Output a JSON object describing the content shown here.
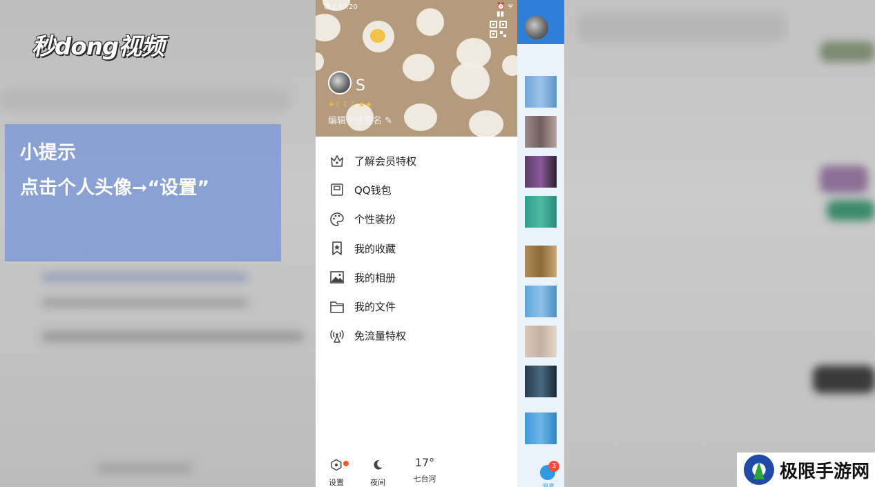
{
  "watermark": {
    "logo_text": "秒dong视频",
    "corner_text": "极限手游网"
  },
  "tip": {
    "title": "小提示",
    "text": "点击个人头像➞“设置”"
  },
  "status_bar": {
    "time": "晚上10:20",
    "icons": "⏰ ᯤ ▮▮"
  },
  "profile": {
    "username": "S",
    "level_icons": "☀☾☾☾★★",
    "signature": "编辑个性签名 ✎"
  },
  "menu": {
    "items": [
      {
        "label": "了解会员特权",
        "icon": "crown-icon"
      },
      {
        "label": "QQ钱包",
        "icon": "wallet-icon"
      },
      {
        "label": "个性装扮",
        "icon": "palette-icon"
      },
      {
        "label": "我的收藏",
        "icon": "bookmark-icon"
      },
      {
        "label": "我的相册",
        "icon": "image-icon"
      },
      {
        "label": "我的文件",
        "icon": "folder-icon"
      },
      {
        "label": "免流量特权",
        "icon": "antenna-icon"
      }
    ]
  },
  "bottom_bar": {
    "settings_label": "设置",
    "night_label": "夜间",
    "temperature": "17°",
    "location": "七台河"
  },
  "side_list": {
    "unread_count": "3",
    "tab_label": "消息"
  },
  "colors": {
    "header_bg": "#b49b7e",
    "accent_blue": "#2f7fd6",
    "badge_red": "#ff4a3d",
    "tip_bg": "#7896d7"
  }
}
